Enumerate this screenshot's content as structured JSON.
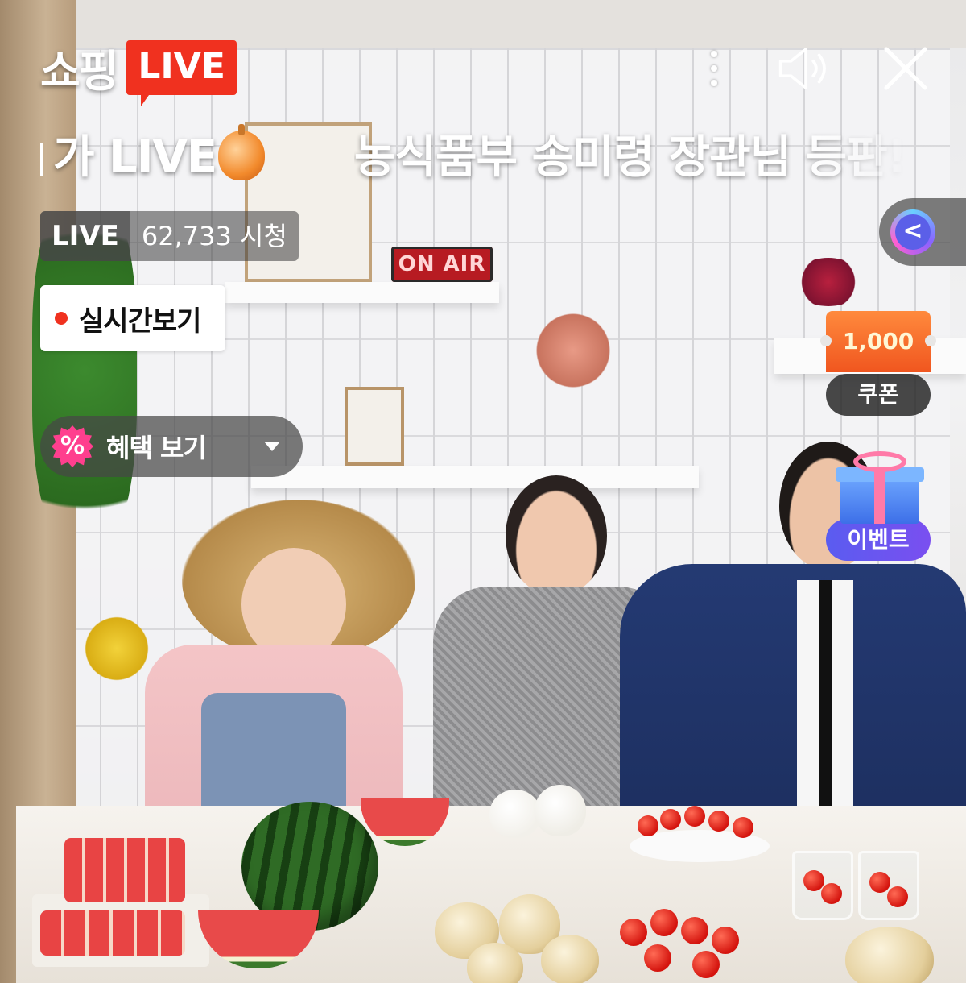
{
  "brand": {
    "name": "쇼핑",
    "live_badge": "LIVE"
  },
  "top_controls": {
    "more_icon": "more-vertical-icon",
    "sound_icon": "speaker-icon",
    "close_icon": "close-icon"
  },
  "marquee": {
    "segment_1": "가 LIVE",
    "segment_2": "농식품부 송미령 장관님 등판!"
  },
  "stats": {
    "live_tag": "LIVE",
    "viewers": "62,733 시청"
  },
  "realtime": {
    "label": "실시간보기"
  },
  "benefit": {
    "icon": "%",
    "label": "혜택 보기"
  },
  "side_tab": {
    "icon": "<"
  },
  "coupon": {
    "amount": "1,000",
    "label": "쿠폰"
  },
  "event": {
    "label": "이벤트"
  },
  "scene": {
    "sign": "ON AIR"
  },
  "colors": {
    "live_red": "#f0311f",
    "coupon_orange": "#f0561f",
    "event_purple": "#6a55f0"
  }
}
